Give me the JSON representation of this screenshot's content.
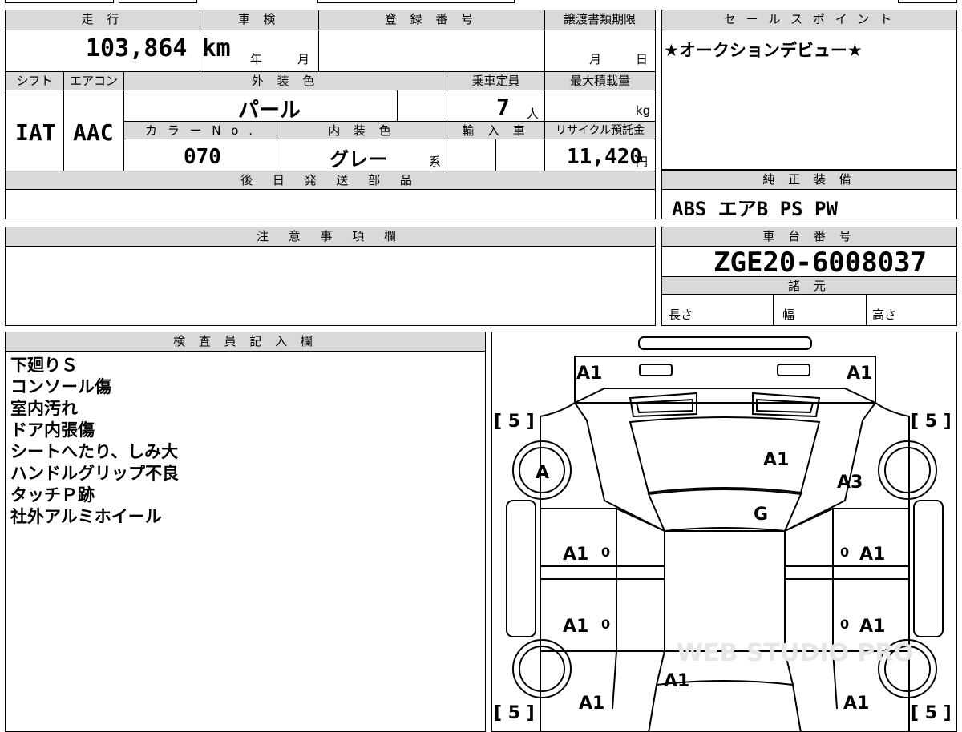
{
  "top_table": {
    "headers": {
      "mileage": "走 行",
      "inspection": "車 検",
      "registration": "登 録 番 号",
      "transfer_deadline": "譲渡書類期限",
      "shift": "シフト",
      "aircon": "エアコン",
      "exterior_color": "外 装 色",
      "capacity": "乗車定員",
      "max_load": "最大積載量",
      "color_no": "カ ラ ー N o .",
      "interior_color": "内 装 色",
      "import": "輸 入 車",
      "recycle_fee": "リサイクル預託金",
      "later_parts": "後 日 発 送 部 品"
    },
    "mileage": "103,864 km",
    "inspection_year_unit": "年",
    "inspection_month_unit": "月",
    "transfer_month_unit": "月",
    "transfer_day_unit": "日",
    "shift": "IAT",
    "aircon": "AAC",
    "exterior_color": "パール",
    "capacity": "7",
    "capacity_unit": "人",
    "max_load_unit": "kg",
    "color_no": "070",
    "interior_color": "グレー",
    "interior_suffix": "系",
    "recycle_fee": "11,420",
    "recycle_unit": "円"
  },
  "sales_point": {
    "header": "セ ー ル ス ポ イ ン ト",
    "text": "★オークションデビュー★"
  },
  "genuine_equipment": {
    "header": "純 正 装 備",
    "text": "ABS エアB PS PW"
  },
  "notes": {
    "header": "注 意 事 項 欄"
  },
  "chassis": {
    "header": "車 台 番 号",
    "number": "ZGE20-6008037"
  },
  "specs": {
    "header": "諸 元",
    "length": "長さ",
    "width": "幅",
    "height": "高さ"
  },
  "inspector": {
    "header": "検 査 員 記 入 欄",
    "lines": [
      "下廻りＳ",
      "コンソール傷",
      "室内汚れ",
      "ドア内張傷",
      "シートへたり、しみ大",
      "ハンドルグリップ不良",
      "タッチＰ跡",
      "社外アルミホイール"
    ]
  },
  "diagram": {
    "front_left": "A1",
    "front_right": "A1",
    "tire_fl": "[ 5 ]",
    "tire_fr": "[ 5 ]",
    "tire_rl": "[ 5 ]",
    "tire_rr": "[ 5 ]",
    "wheel_fl": "A",
    "hood": "A1",
    "fender_fr": "A3",
    "windshield": "G",
    "door_fl": "A1",
    "door_fl_code": "0",
    "door_fr": "A1",
    "door_fr_code": "0",
    "door_rl": "A1",
    "door_rl_code": "0",
    "door_rr": "A1",
    "door_rr_code": "0",
    "rear_center": "A1",
    "rear_left": "A1",
    "rear_right": "A1",
    "watermark": "WEB STUDIO PRO"
  }
}
